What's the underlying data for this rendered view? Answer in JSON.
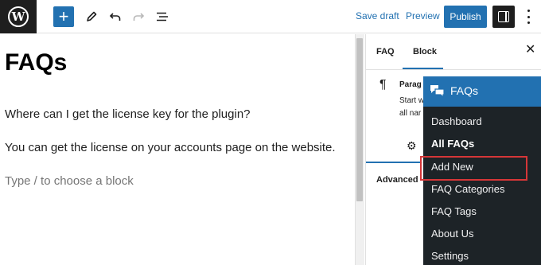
{
  "toolbar": {
    "save_draft_label": "Save draft",
    "preview_label": "Preview",
    "publish_label": "Publish",
    "add_block_symbol": "+"
  },
  "editor": {
    "title": "FAQs",
    "paragraphs": [
      "Where can I get the license key for the plugin?",
      "You can get the license on your accounts page on the website."
    ],
    "block_placeholder": "Type / to choose a block"
  },
  "sidebar": {
    "tabs": [
      "FAQ",
      "Block"
    ],
    "active_tab": "Block",
    "close_symbol": "✕",
    "block_icon": "¶",
    "block_name": "Parag",
    "block_desc_line1": "Start w",
    "block_desc_line2": "all nar",
    "advanced_label": "Advanced"
  },
  "admin_menu": {
    "title": "FAQs",
    "items": [
      "Dashboard",
      "All FAQs",
      "Add New",
      "FAQ Categories",
      "FAQ Tags",
      "About Us",
      "Settings"
    ],
    "current_item": "All FAQs",
    "highlighted_item": "Add New"
  },
  "colors": {
    "accent": "#2271b1",
    "admin_menu_bg": "#1d2327",
    "highlight_border": "#d63638",
    "dark": "#1e1e1e"
  },
  "icons": {
    "logo": "wordpress-logo-icon",
    "tools": [
      "pencil-icon",
      "undo-icon",
      "redo-icon",
      "list-view-icon"
    ],
    "settings": "settings-sidebar-icon",
    "options": "kebab-menu-icon",
    "gear": "gear-icon",
    "menu_header": "faq-bubbles-icon"
  }
}
